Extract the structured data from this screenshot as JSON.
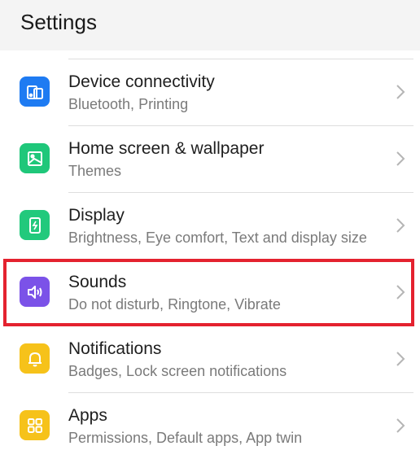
{
  "header": {
    "title": "Settings"
  },
  "items": [
    {
      "label": "Device connectivity",
      "sub": "Bluetooth, Printing",
      "icon": "device-connectivity-icon",
      "color": "#1e7bf2"
    },
    {
      "label": "Home screen & wallpaper",
      "sub": "Themes",
      "icon": "wallpaper-icon",
      "color": "#1fc77a"
    },
    {
      "label": "Display",
      "sub": "Brightness, Eye comfort, Text and display size",
      "icon": "display-icon",
      "color": "#22c97c"
    },
    {
      "label": "Sounds",
      "sub": "Do not disturb, Ringtone, Vibrate",
      "icon": "sound-icon",
      "color": "#7b52e8"
    },
    {
      "label": "Notifications",
      "sub": "Badges, Lock screen notifications",
      "icon": "bell-icon",
      "color": "#f6c21a"
    },
    {
      "label": "Apps",
      "sub": "Permissions, Default apps, App twin",
      "icon": "apps-grid-icon",
      "color": "#f6c21a"
    }
  ],
  "highlight": {
    "color": "#e4222f"
  }
}
